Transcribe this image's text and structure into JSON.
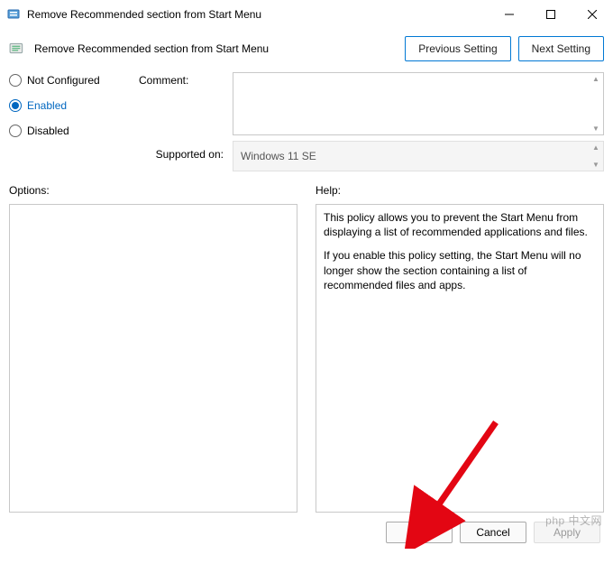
{
  "titlebar": {
    "title": "Remove Recommended section from Start Menu"
  },
  "header": {
    "title": "Remove Recommended section from Start Menu",
    "prev_label": "Previous Setting",
    "next_label": "Next Setting"
  },
  "state": {
    "options": [
      "Not Configured",
      "Enabled",
      "Disabled"
    ],
    "selected_index": 1
  },
  "mid": {
    "comment_label": "Comment:",
    "supported_label": "Supported on:",
    "supported_value": "Windows 11 SE"
  },
  "lower": {
    "options_label": "Options:",
    "help_label": "Help:",
    "help_p1": "This policy allows you to prevent the Start Menu from displaying a list of recommended applications and files.",
    "help_p2": "If you enable this policy setting, the Start Menu will no longer show the section containing a list of recommended files and apps."
  },
  "footer": {
    "ok": "OK",
    "cancel": "Cancel",
    "apply": "Apply"
  },
  "watermark": "php 中文网"
}
